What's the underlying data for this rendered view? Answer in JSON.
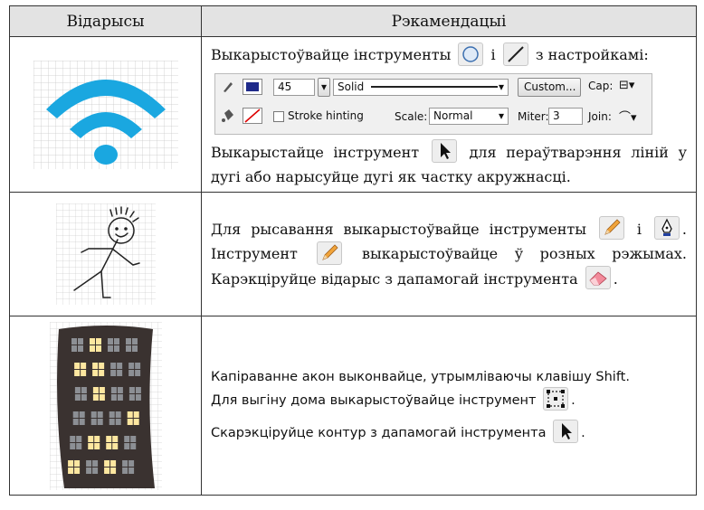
{
  "headers": {
    "col1": "Відарысы",
    "col2": "Рэкамендацыі"
  },
  "row1": {
    "line1_a": "Выкарыстоўвайце інструменты",
    "line1_b": "і",
    "line1_c": "з настройкамі:",
    "panel": {
      "stroke_width": "45",
      "style": "Solid",
      "custom_button": "Custom...",
      "cap_label": "Cap:",
      "stroke_hinting": "Stroke hinting",
      "scale_label": "Scale:",
      "scale_value": "Normal",
      "miter_label": "Miter:",
      "miter_value": "3",
      "join_label": "Join:"
    },
    "line2_a": "Выкарыстайце інструмент",
    "line2_b": "для пераўтварэння ліній у дугі або нарысуйце дугі як частку акружнасці."
  },
  "row2": {
    "a": "Для рысавання выкарыстоўвайце інструменты",
    "b": "і",
    "c": ". Інструмент",
    "d": "выкарыстоўвайце ў розных рэжымах. Карэкціруйце відарыс з дапамогай інструмента",
    "e": "."
  },
  "row3": {
    "p1": "Капіраванне акон выконвайце, утрымліваючы клавішу Shift.",
    "p2_a": "Для выгіну дома выкарыстоўвайце інструмент",
    "p2_b": ".",
    "p3_a": "Скарэкціруйце контур з дапамогай інструмента",
    "p3_b": "."
  },
  "colors": {
    "wifi_blue": "#1aa7e0",
    "stroke_swatch": "#1f2a8a",
    "building": "#3a3230",
    "window_lit": "#fde7a0",
    "window_dark": "#8c8f94",
    "header_bg": "#e3e3e3"
  },
  "icons": [
    "oval-tool-icon",
    "line-tool-icon",
    "selection-tool-icon",
    "pencil-tool-icon",
    "pen-tool-icon",
    "eraser-tool-icon",
    "free-transform-tool-icon"
  ]
}
